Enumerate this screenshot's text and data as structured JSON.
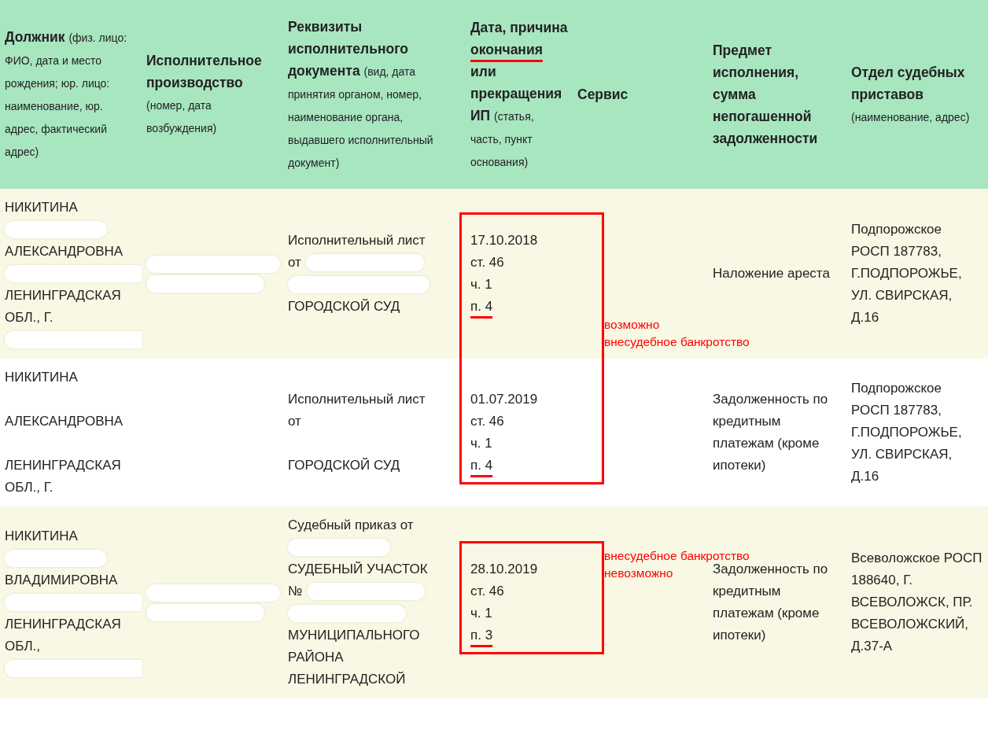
{
  "table": {
    "columns": [
      {
        "title": [
          {
            "text": "Должник"
          }
        ],
        "note": "(физ. лицо: ФИО, дата и место рождения; юр. лицо: наименование, юр. адрес, фактический адрес)"
      },
      {
        "title": [
          {
            "text": "Исполнительное производство"
          }
        ],
        "note": "(номер, дата возбуждения)"
      },
      {
        "title": [
          {
            "text": "Реквизиты исполнительного документа"
          }
        ],
        "note": "(вид, дата принятия органом, номер, наименование органа, выдавшего исполнительный документ)"
      },
      {
        "title": [
          {
            "text": "Дата, причина"
          },
          {
            "text": "окончания",
            "underlined": true
          },
          {
            "text": "или прекращения ИП"
          }
        ],
        "note": "(статья, часть, пункт основания)"
      },
      {
        "title": [
          {
            "text": "Сервис"
          }
        ]
      },
      {
        "title": [
          {
            "text": "Предмет исполнения, сумма непогашенной задолженности"
          }
        ]
      },
      {
        "title": [
          {
            "text": "Отдел судебных приставов"
          }
        ],
        "note": "(наименование, адрес)"
      }
    ],
    "rows": [
      {
        "shaded": true,
        "debtor": [
          {
            "text": "НИКИТИНА",
            "redacted_below": true
          },
          {
            "text": "АЛЕКСАНДРОВНА",
            "redacted_below": true
          },
          {
            "text": "ЛЕНИНГРАДСКАЯ"
          },
          {
            "text": "ОБЛ., Г.",
            "redacted_below": true
          }
        ],
        "proceeding_redacted": true,
        "document": [
          {
            "text": "Исполнительный лист"
          },
          {
            "text": "от",
            "redacted_after": true,
            "redacted_below": true
          },
          {
            "text": "ГОРОДСКОЙ СУД"
          }
        ],
        "end": {
          "lines": [
            "17.10.2018",
            "ст. 46",
            "ч. 1",
            "п. 4"
          ],
          "underline_last": true,
          "boxed": true,
          "box_continues": true
        },
        "service_note": {
          "lines": [
            "возможно",
            "внесудебное банкротство"
          ],
          "at_bottom": true
        },
        "subject": "Наложение ареста",
        "department": "Подпорожское РОСП 187783, Г.ПОДПОРОЖЬЕ, УЛ. СВИРСКАЯ, Д.16"
      },
      {
        "shaded": false,
        "debtor": [
          {
            "text": "НИКИТИНА",
            "gap_below": true
          },
          {
            "text": "АЛЕКСАНДРОВНА",
            "gap_below": true
          },
          {
            "text": "ЛЕНИНГРАДСКАЯ"
          },
          {
            "text": "ОБЛ., Г."
          }
        ],
        "proceeding_redacted": false,
        "document": [
          {
            "text": "Исполнительный лист"
          },
          {
            "text": "от",
            "gap_below": true
          },
          {
            "text": "ГОРОДСКОЙ СУД"
          }
        ],
        "end": {
          "lines": [
            "01.07.2019",
            "ст. 46",
            "ч. 1",
            "п. 4"
          ],
          "underline_last": true,
          "boxed": true
        },
        "subject": "Задолженность по кредитным платежам (кроме ипотеки)",
        "department": "Подпорожское РОСП 187783, Г.ПОДПОРОЖЬЕ, УЛ. СВИРСКАЯ, Д.16"
      },
      {
        "shaded": true,
        "debtor": [
          {
            "text": "НИКИТИНА",
            "redacted_below": true
          },
          {
            "text": "ВЛАДИМИРОВНА",
            "redacted_below": true
          },
          {
            "text": "ЛЕНИНГРАДСКАЯ"
          },
          {
            "text": "ОБЛ.,",
            "redacted_below": true
          }
        ],
        "proceeding_redacted": true,
        "document": [
          {
            "text": "Судебный приказ от",
            "redacted_below": true
          },
          {
            "text": "СУДЕБНЫЙ УЧАСТОК"
          },
          {
            "text": "№",
            "redacted_after": true,
            "redacted_below": true
          },
          {
            "text": "МУНИЦИПАЛЬНОГО"
          },
          {
            "text": "РАЙОНА"
          },
          {
            "text": "ЛЕНИНГРАДСКОЙ"
          }
        ],
        "end": {
          "lines": [
            "28.10.2019",
            "ст. 46",
            "ч. 1",
            "п. 3"
          ],
          "underline_last": true,
          "boxed": true
        },
        "service_note": {
          "lines": [
            "внесудебное банкротство",
            "невозможно"
          ],
          "at_bottom": false
        },
        "subject": "Задолженность по кредитным платежам (кроме ипотеки)",
        "department": "Всеволожское РОСП 188640, Г. ВСЕВОЛОЖСК, ПР. ВСЕВОЛОЖСКИЙ, Д.37-А"
      }
    ]
  }
}
